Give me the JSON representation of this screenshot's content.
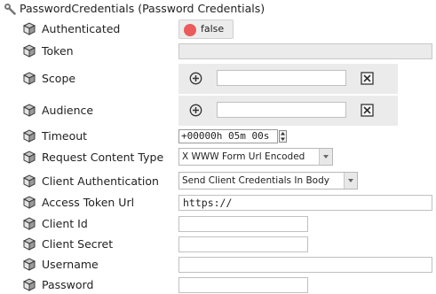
{
  "header": {
    "title": "PasswordCredentials  (Password Credentials)",
    "icon": "wrench-icon"
  },
  "properties": {
    "authenticated": {
      "label": "Authenticated",
      "value": "false",
      "status_color": "#ec5b5b"
    },
    "token": {
      "label": "Token",
      "value": ""
    },
    "scope": {
      "label": "Scope",
      "value": ""
    },
    "audience": {
      "label": "Audience",
      "value": ""
    },
    "timeout": {
      "label": "Timeout",
      "value": "+00000h 05m 00s"
    },
    "request_content_type": {
      "label": "Request Content Type",
      "value": "X WWW Form Url Encoded"
    },
    "client_authentication": {
      "label": "Client Authentication",
      "value": "Send Client Credentials In Body"
    },
    "access_token_url": {
      "label": "Access Token Url",
      "value": "https://"
    },
    "client_id": {
      "label": "Client Id",
      "value": ""
    },
    "client_secret": {
      "label": "Client Secret",
      "value": ""
    },
    "username": {
      "label": "Username",
      "value": ""
    },
    "password": {
      "label": "Password",
      "value": ""
    }
  },
  "icons": {
    "property": "cube-icon",
    "add": "plus-circle-icon",
    "remove": "close-box-icon",
    "spinner": "spinner-icon",
    "dropdown": "chevron-down-icon"
  }
}
